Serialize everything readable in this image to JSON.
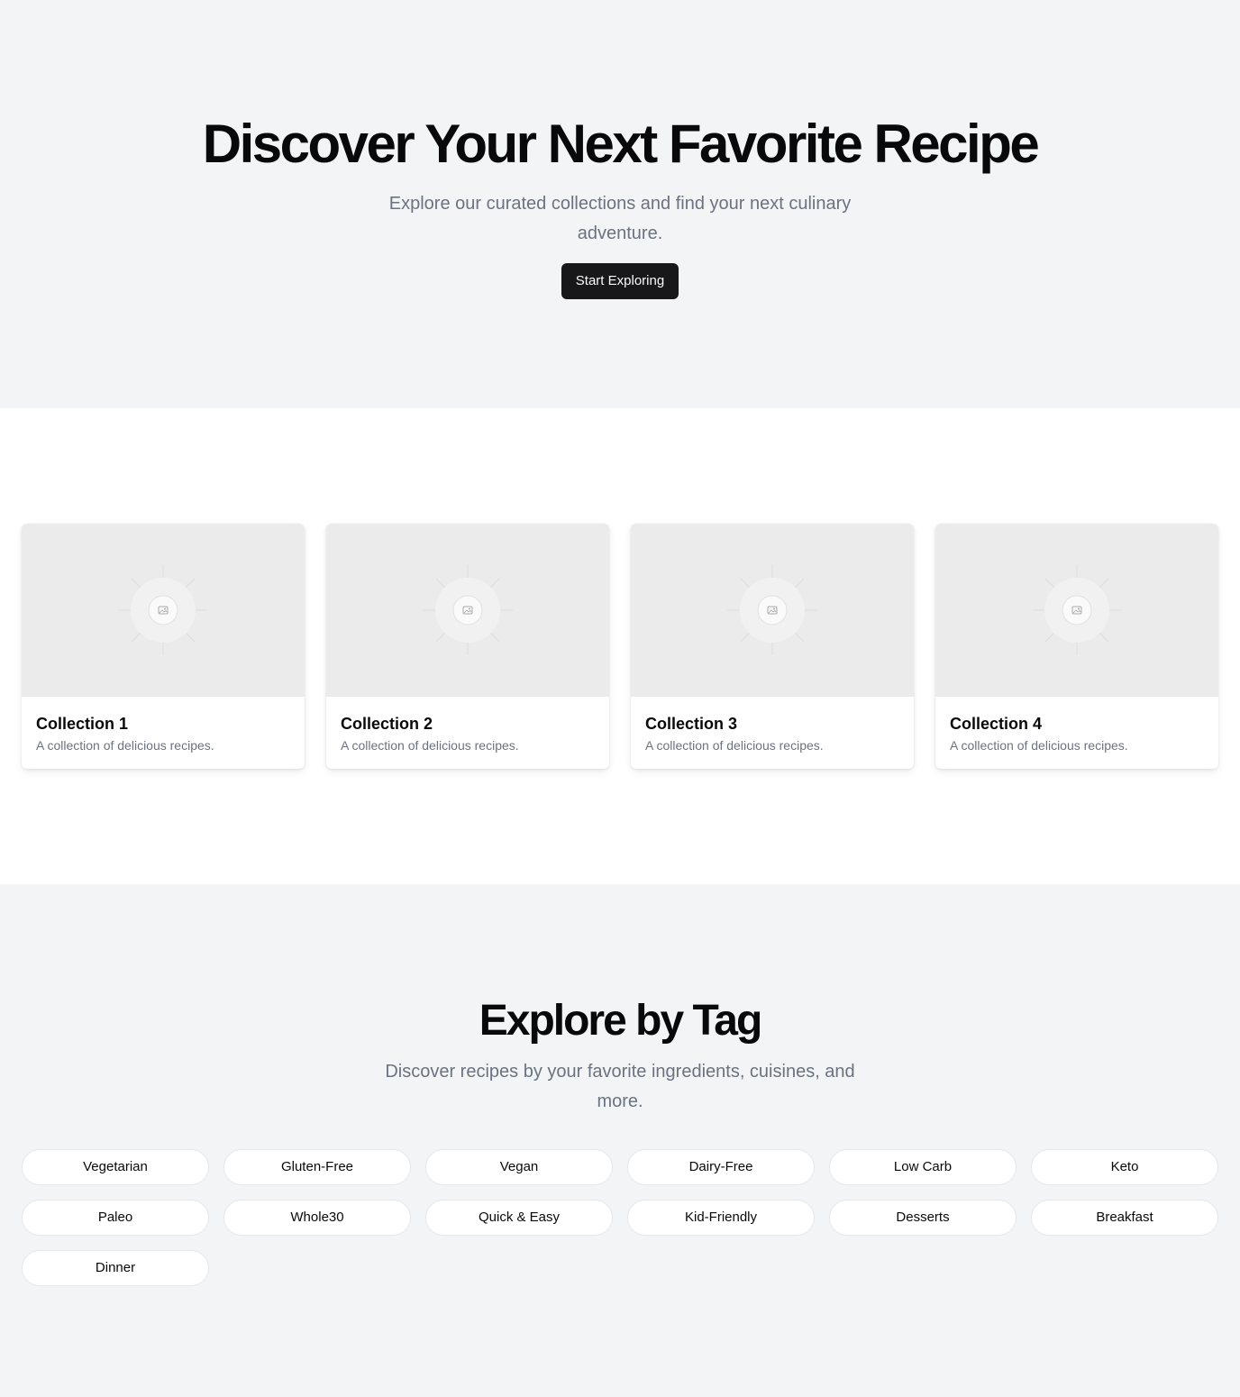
{
  "hero": {
    "title": "Discover Your Next Favorite Recipe",
    "subtitle": "Explore our curated collections and find your next culinary adventure.",
    "cta_label": "Start Exploring"
  },
  "collections": [
    {
      "title": "Collection 1",
      "description": "A collection of delicious recipes.",
      "image_icon": "image-placeholder-icon"
    },
    {
      "title": "Collection 2",
      "description": "A collection of delicious recipes.",
      "image_icon": "image-placeholder-icon"
    },
    {
      "title": "Collection 3",
      "description": "A collection of delicious recipes.",
      "image_icon": "image-placeholder-icon"
    },
    {
      "title": "Collection 4",
      "description": "A collection of delicious recipes.",
      "image_icon": "image-placeholder-icon"
    }
  ],
  "tags_section": {
    "title": "Explore by Tag",
    "subtitle": "Discover recipes by your favorite ingredients, cuisines, and more.",
    "tags": [
      "Vegetarian",
      "Gluten-Free",
      "Vegan",
      "Dairy-Free",
      "Low Carb",
      "Keto",
      "Paleo",
      "Whole30",
      "Quick & Easy",
      "Kid-Friendly",
      "Desserts",
      "Breakfast",
      "Dinner"
    ]
  },
  "colors": {
    "page_background_alt": "#f3f4f6",
    "primary_button": "#18181b",
    "muted_text": "#6b7280",
    "placeholder_image": "#ebebeb"
  }
}
